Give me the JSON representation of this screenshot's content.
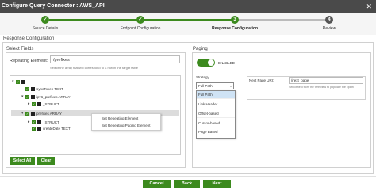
{
  "window": {
    "title": "Configure Query Connector : AWS_API",
    "close_glyph": "✕"
  },
  "stepper": {
    "steps": [
      {
        "number": "1",
        "label": "Source Details",
        "state": "done"
      },
      {
        "number": "2",
        "label": "Endpoint Configuration",
        "state": "done"
      },
      {
        "number": "3",
        "label": "Response Configuration",
        "state": "active"
      },
      {
        "number": "4",
        "label": "Review",
        "state": "pending"
      }
    ],
    "colors": {
      "done": "#3c8a1e",
      "active": "#3c8a1e",
      "pending": "#555555"
    }
  },
  "response_config": {
    "title": "Response Configuration",
    "select_fields": {
      "title": "Select Fields",
      "repeating_label": "Repeating Element:",
      "repeating_value": "/prefixes",
      "hint": "Select the array that will correspond to a row in the target table",
      "tree": [
        {
          "text": "",
          "type_icon": "object-icon",
          "caret": "▾",
          "checked": true,
          "highlight": false
        },
        {
          "text": "syncToken TEXT",
          "type_icon": "text-icon",
          "caret": "",
          "checked": true,
          "highlight": false
        },
        {
          "text": "ipv6_prefixes ARRAY",
          "type_icon": "array-icon",
          "caret": "▾",
          "checked": true,
          "highlight": false
        },
        {
          "text": "_STRUCT",
          "type_icon": "struct-icon",
          "caret": "▸",
          "checked": true,
          "highlight": false
        },
        {
          "text": "prefixes ARRAY",
          "type_icon": "array-icon",
          "caret": "▾",
          "checked": true,
          "highlight": true
        },
        {
          "text": "_STRUCT",
          "type_icon": "struct-icon",
          "caret": "▸",
          "checked": true,
          "highlight": false
        },
        {
          "text": "createDate TEXT",
          "type_icon": "text-icon",
          "caret": "",
          "checked": true,
          "highlight": false
        }
      ],
      "context_menu": [
        "Set Repeating Element",
        "Set Repeating Paging Element"
      ],
      "select_all_label": "Select All",
      "clear_label": "Clear"
    },
    "paging": {
      "title": "Paging",
      "toggle_on": true,
      "toggle_label": "ENABLED",
      "strategy_label": "Strategy",
      "strategy_value": "Full Path",
      "strategy_options": [
        "Full Path",
        "Link Header",
        "Offset-based",
        "Cursor-based",
        "Page Based"
      ],
      "next_page_label": "Next Page URI:",
      "next_page_value": "/next_page",
      "next_page_hint": "Select field from the tree view to populate the xpath"
    }
  },
  "footer": {
    "cancel_label": "Cancel",
    "back_label": "Back",
    "next_label": "Next"
  },
  "colors": {
    "accent": "#3c8a1e",
    "titlebar": "#4a4a4a",
    "selected_option": "#cfe3f5"
  }
}
